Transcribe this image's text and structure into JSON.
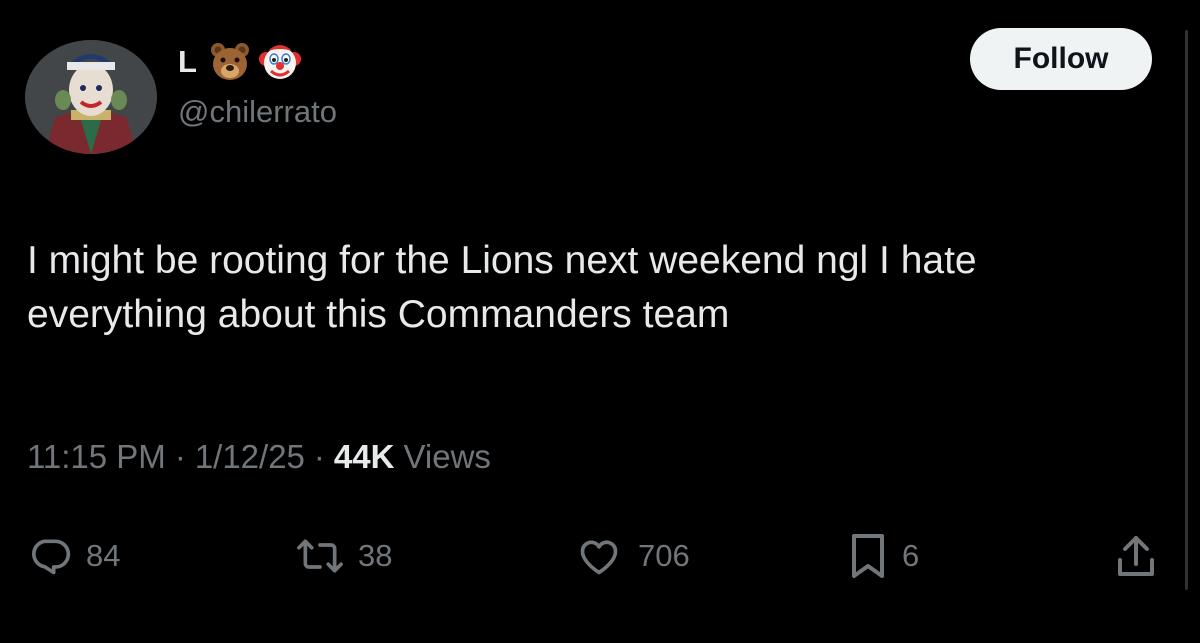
{
  "author": {
    "display_name": "L",
    "emojis": [
      "bear-face-emoji",
      "clown-face-emoji"
    ],
    "handle": "@chilerrato"
  },
  "follow_label": "Follow",
  "tweet": {
    "text": "I might be rooting for the Lions next weekend ngl I hate everything about this Commanders team",
    "time": "11:15 PM",
    "separator": "·",
    "date": "1/12/25",
    "views_count": "44K",
    "views_label": "Views"
  },
  "actions": {
    "replies": "84",
    "reposts": "38",
    "likes": "706",
    "bookmarks": "6"
  },
  "colors": {
    "background": "#000000",
    "text_primary": "#e7e9ea",
    "text_secondary": "#71767b",
    "follow_bg": "#eff3f4",
    "follow_text": "#0f1419"
  }
}
